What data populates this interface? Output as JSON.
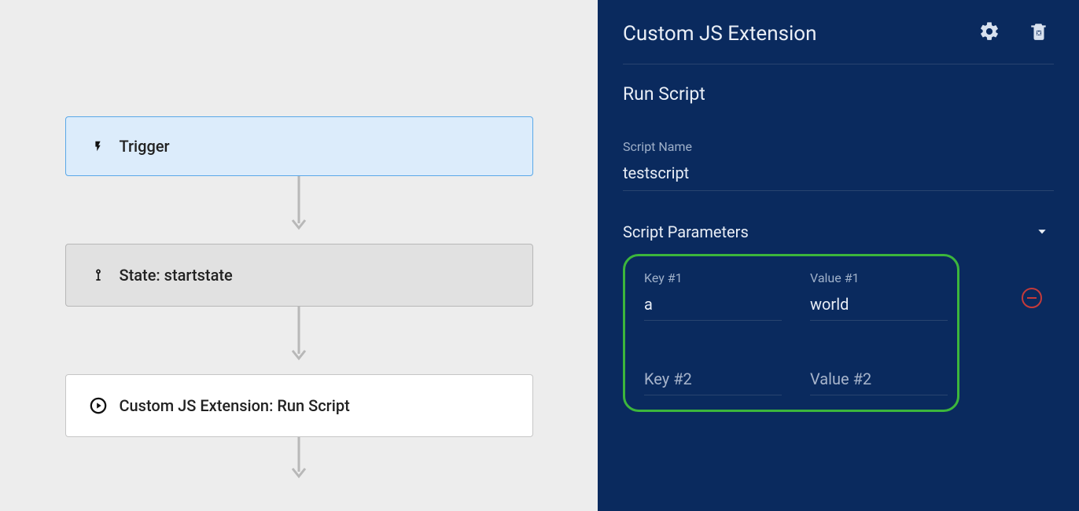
{
  "canvas": {
    "nodes": {
      "trigger_label": "Trigger",
      "state_label": "State: startstate",
      "action_label": "Custom JS Extension: Run Script"
    }
  },
  "panel": {
    "title": "Custom JS Extension",
    "subtitle": "Run Script",
    "script_name_label": "Script Name",
    "script_name_value": "testscript",
    "params_section_label": "Script Parameters",
    "params": [
      {
        "key_label": "Key #1",
        "key_value": "a",
        "value_label": "Value #1",
        "value_value": "world"
      },
      {
        "key_label": "Key #2",
        "key_value": "",
        "value_label": "Value #2",
        "value_value": ""
      }
    ]
  },
  "colors": {
    "panel_bg": "#0a2a5e",
    "highlight": "#3cb63c",
    "remove": "#c53a3a"
  }
}
